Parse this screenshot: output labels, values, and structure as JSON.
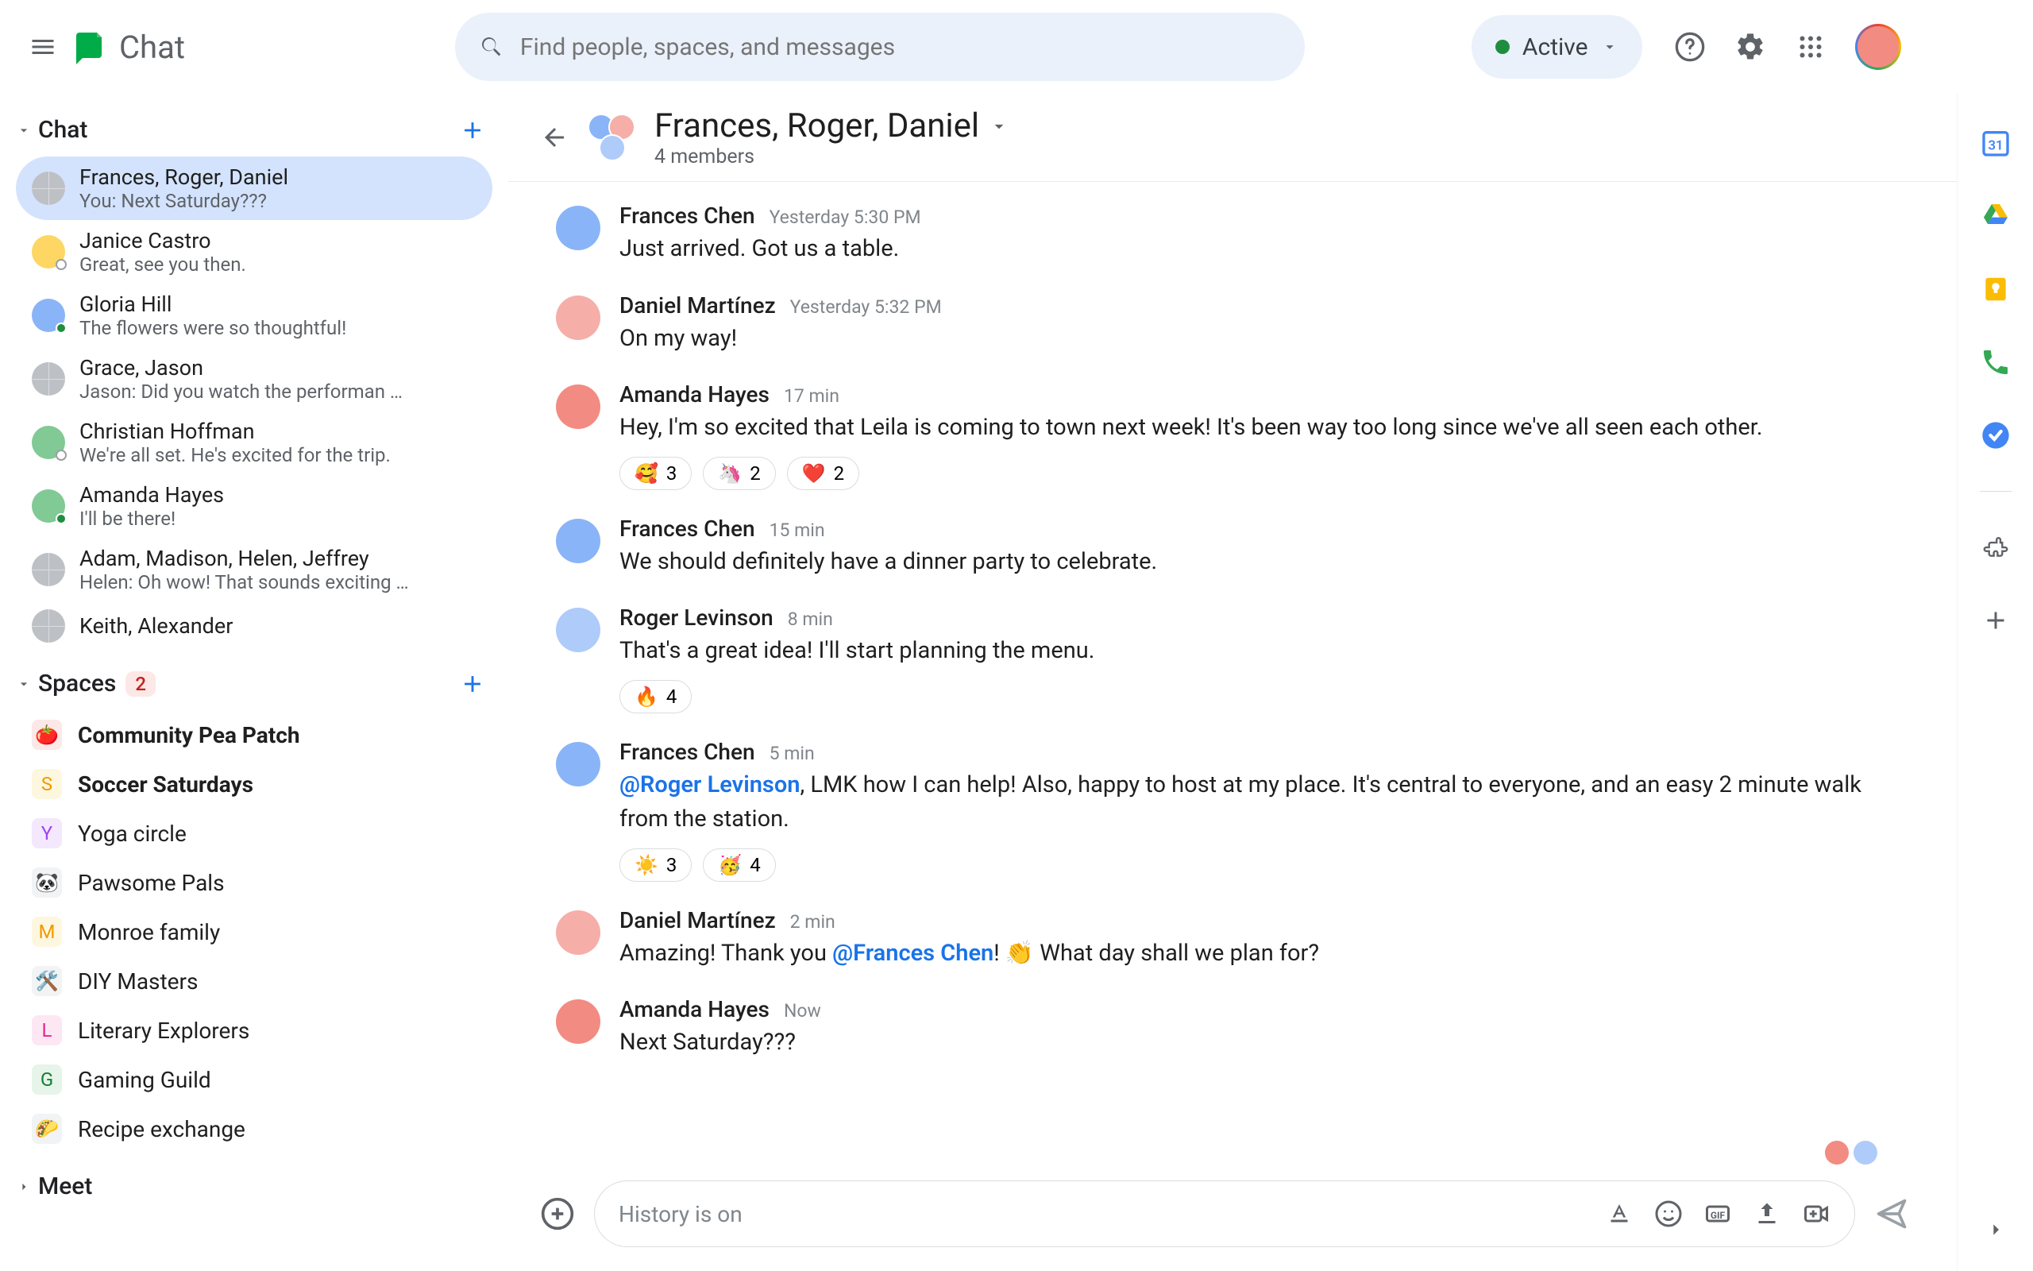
{
  "app": {
    "title": "Chat"
  },
  "search": {
    "placeholder": "Find people, spaces, and messages"
  },
  "status": {
    "label": "Active"
  },
  "sidebar": {
    "chat_label": "Chat",
    "spaces_label": "Spaces",
    "spaces_badge": "2",
    "meet_label": "Meet",
    "chats": [
      {
        "name": "Frances, Roger, Daniel",
        "snippet": "You: Next Saturday???",
        "active": true,
        "group": true
      },
      {
        "name": "Janice Castro",
        "snippet": "Great, see you then.",
        "status": "offline"
      },
      {
        "name": "Gloria Hill",
        "snippet": "The flowers were so thoughtful!",
        "status": "online"
      },
      {
        "name": "Grace, Jason",
        "snippet": "Jason: Did you watch the performan …",
        "group": true
      },
      {
        "name": "Christian Hoffman",
        "snippet": "We're all set.  He's excited for the trip.",
        "status": "offline"
      },
      {
        "name": "Amanda Hayes",
        "snippet": "I'll be there!",
        "status": "online"
      },
      {
        "name": "Adam, Madison, Helen, Jeffrey",
        "snippet": "Helen: Oh wow! That sounds exciting …",
        "group": true
      },
      {
        "name": "Keith, Alexander",
        "snippet": "",
        "group": true
      }
    ],
    "spaces": [
      {
        "icon": "🍅",
        "name": "Community Pea Patch",
        "bold": true,
        "bg": "#fce8e6"
      },
      {
        "icon": "S",
        "name": "Soccer Saturdays",
        "bold": true,
        "bg": "#fef7e0",
        "fg": "#f29900"
      },
      {
        "icon": "Y",
        "name": "Yoga circle",
        "bg": "#f3e8fd",
        "fg": "#a142f4"
      },
      {
        "icon": "🐼",
        "name": "Pawsome Pals",
        "bg": "#f1f3f4"
      },
      {
        "icon": "M",
        "name": "Monroe family",
        "bg": "#fef7e0",
        "fg": "#f29900"
      },
      {
        "icon": "🛠️",
        "name": "DIY Masters",
        "bg": "#f1f3f4"
      },
      {
        "icon": "L",
        "name": "Literary Explorers",
        "bg": "#fde7f3",
        "fg": "#e52592"
      },
      {
        "icon": "G",
        "name": "Gaming Guild",
        "bg": "#e6f4ea",
        "fg": "#188038"
      },
      {
        "icon": "🌮",
        "name": "Recipe exchange",
        "bg": "#f1f3f4"
      }
    ]
  },
  "chat": {
    "title": "Frances, Roger, Daniel",
    "subtitle": "4 members",
    "messages": [
      {
        "author": "Frances Chen",
        "time": "Yesterday 5:30 PM",
        "text": "Just arrived.  Got us a table.",
        "color": "#8ab4f8"
      },
      {
        "author": "Daniel Martínez",
        "time": "Yesterday 5:32 PM",
        "text": "On my way!",
        "color": "#f6aea9"
      },
      {
        "author": "Amanda Hayes",
        "time": "17 min",
        "text": "Hey, I'm so excited that Leila is coming to town next week! It's been way too long since we've all seen each other.",
        "color": "#f28b82",
        "reactions": [
          {
            "emoji": "🥰",
            "count": "3"
          },
          {
            "emoji": "🦄",
            "count": "2"
          },
          {
            "emoji": "❤️",
            "count": "2"
          }
        ]
      },
      {
        "author": "Frances Chen",
        "time": "15 min",
        "text": "We should definitely have a dinner party to celebrate.",
        "color": "#8ab4f8"
      },
      {
        "author": "Roger Levinson",
        "time": "8 min",
        "text": "That's a great idea! I'll start planning the menu.",
        "color": "#aecbfa",
        "reactions": [
          {
            "emoji": "🔥",
            "count": "4"
          }
        ]
      },
      {
        "author": "Frances Chen",
        "time": "5 min",
        "mention1": "@Roger Levinson",
        "text_after_mention1": ", LMK how I can help!  Also, happy to host at my place. It's central to everyone, and an easy 2 minute walk from the station.",
        "color": "#8ab4f8",
        "reactions": [
          {
            "emoji": "☀️",
            "count": "3"
          },
          {
            "emoji": "🥳",
            "count": "4"
          }
        ]
      },
      {
        "author": "Daniel Martínez",
        "time": "2 min",
        "pre": "Amazing! Thank you ",
        "mention1": "@Frances Chen",
        "post": "! 👏 What day shall we plan for?",
        "color": "#f6aea9"
      },
      {
        "author": "Amanda Hayes",
        "time": "Now",
        "text": "Next Saturday???",
        "color": "#f28b82"
      }
    ]
  },
  "composer": {
    "placeholder": "History is on"
  }
}
